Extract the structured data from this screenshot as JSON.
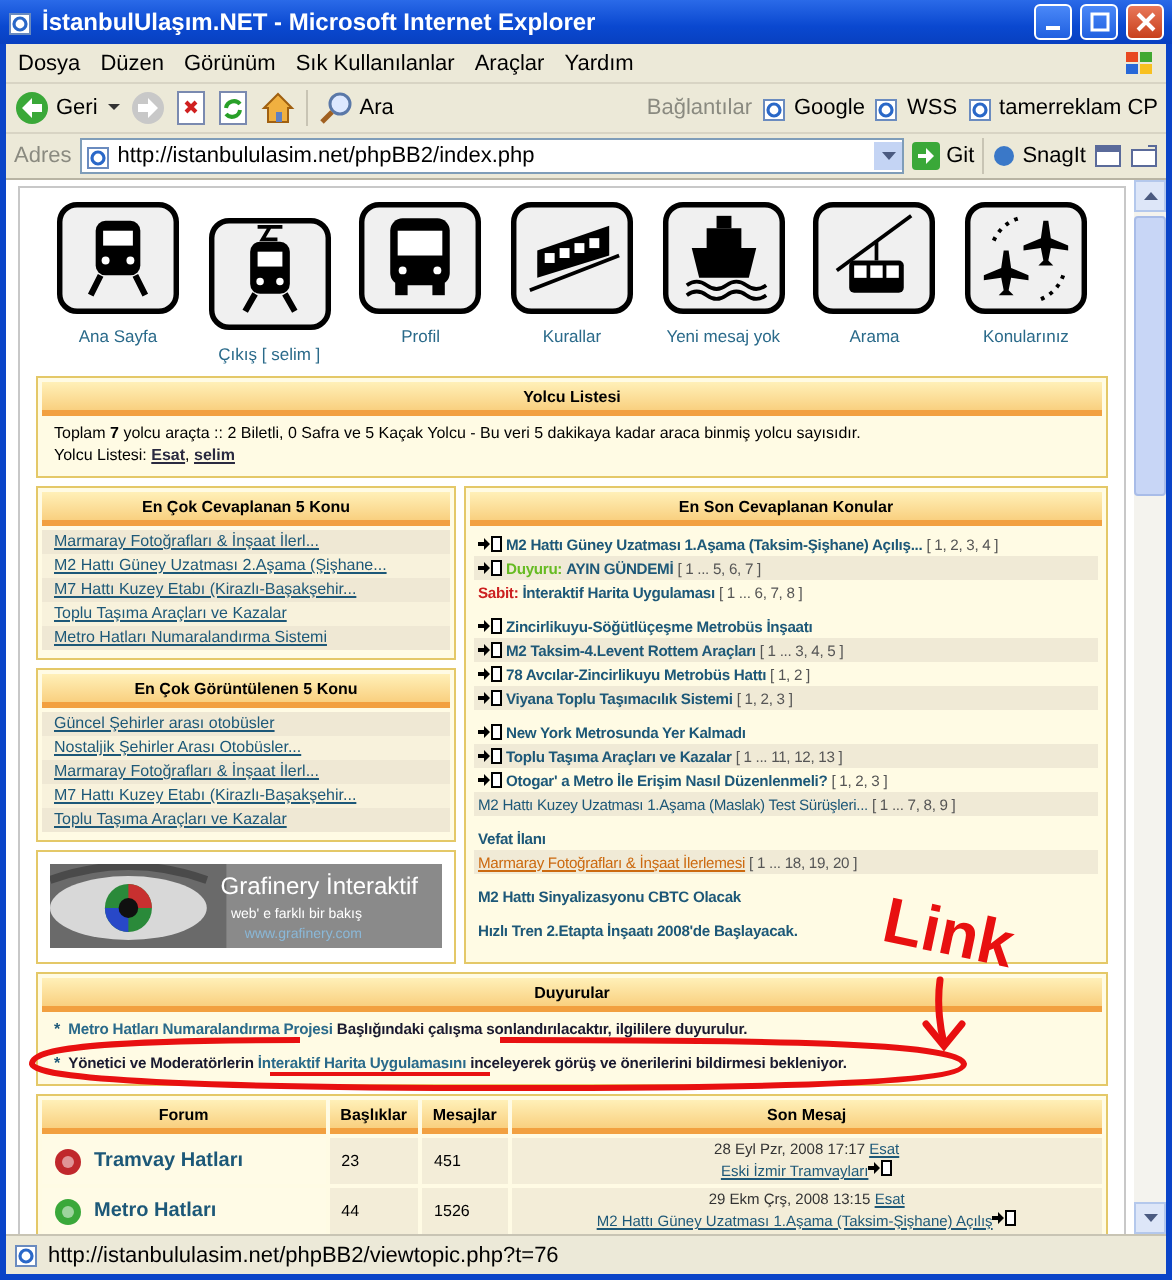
{
  "window": {
    "title": "İstanbulUlaşım.NET - Microsoft Internet Explorer"
  },
  "menu": [
    "Dosya",
    "Düzen",
    "Görünüm",
    "Sık Kullanılanlar",
    "Araçlar",
    "Yardım"
  ],
  "toolbar": {
    "back": "Geri",
    "search": "Ara",
    "links_label": "Bağlantılar",
    "links": [
      "Google",
      "WSS",
      "tamerreklam CP"
    ]
  },
  "address": {
    "label": "Adres",
    "url": "http://istanbululasim.net/phpBB2/index.php",
    "go": "Git",
    "snagit": "SnagIt"
  },
  "nav": [
    {
      "label": "Ana Sayfa",
      "kind": "metro"
    },
    {
      "label": "Çıkış [ selim ]",
      "kind": "tram"
    },
    {
      "label": "Profil",
      "kind": "bus"
    },
    {
      "label": "Kurallar",
      "kind": "funicular"
    },
    {
      "label": "Yeni mesaj yok",
      "kind": "ship"
    },
    {
      "label": "Arama",
      "kind": "cablecar"
    },
    {
      "label": "Konularınız",
      "kind": "planes"
    }
  ],
  "online": {
    "title": "Yolcu Listesi",
    "summary": "Toplam **7** yolcu araçta :: 2 Biletli, 0 Safra ve 5 Kaçak Yolcu - Bu veri 5 dakikaya kadar araca binmiş yolcu sayısıdır.",
    "list_label": "Yolcu Listesi:",
    "users": [
      "Esat",
      "selim"
    ],
    "separator": ","
  },
  "most_replied": {
    "title": "En Çok Cevaplanan 5 Konu",
    "items": [
      "Marmaray Fotoğrafları & İnşaat İlerl...",
      "M2 Hattı Güney Uzatması 2.Aşama (Şişhane...",
      "M7 Hattı Kuzey Etabı (Kirazlı-Başakşehir...",
      "Toplu Taşıma Araçları ve Kazalar",
      "Metro Hatları Numaralandırma Sistemi"
    ]
  },
  "most_viewed": {
    "title": "En Çok Görüntülenen 5 Konu",
    "items": [
      "Güncel Şehirler arası otobüsler",
      "Nostaljik Şehirler Arası Otobüsler...",
      "Marmaray Fotoğrafları & İnşaat İlerl...",
      "M7 Hattı Kuzey Etabı (Kirazlı-Başakşehir...",
      "Toplu Taşıma Araçları ve Kazalar"
    ]
  },
  "banner": {
    "title": "Grafinery İnteraktif",
    "tagline": "web' e farklı bir bakış",
    "url": "www.grafinery.com"
  },
  "latest": {
    "title": "En Son Cevaplanan Konular",
    "groups": [
      {
        "topics": [
          {
            "kind": "topic",
            "title": "M2 Hattı Güney Uzatması 1.Aşama (Taksim-Şişhane) Açılış...",
            "pages": "[ 1, 2, 3, 4 ]",
            "color": "#1d5878"
          },
          {
            "kind": "topic",
            "prefix": {
              "text": "Duyuru:",
              "color": "#66bb22"
            },
            "title": "AYIN GÜNDEMİ",
            "pages": "[ 1 ... 5, 6, 7 ]",
            "color": "#1d5878"
          },
          {
            "kind": "link",
            "prefix": {
              "text": "Sabit:",
              "color": "#cc2020"
            },
            "title": "İnteraktif Harita Uygulaması",
            "pages": "[ 1 ... 6, 7, 8 ]",
            "color": "#1d5878"
          }
        ]
      },
      {
        "topics": [
          {
            "kind": "topic",
            "title": "Zincirlikuyu-Söğütlüçeşme Metrobüs İnşaatı",
            "color": "#1d5878"
          },
          {
            "kind": "topic",
            "title": "M2 Taksim-4.Levent Rottem Araçları",
            "pages": "[ 1 ... 3, 4, 5 ]",
            "color": "#1d5878"
          },
          {
            "kind": "topic",
            "title": "78 Avcılar-Zincirlikuyu Metrobüs Hattı",
            "pages": "[ 1, 2 ]",
            "color": "#1d5878"
          },
          {
            "kind": "topic",
            "title": "Viyana Toplu Taşımacılık Sistemi",
            "pages": "[ 1, 2, 3 ]",
            "color": "#1d5878"
          }
        ]
      },
      {
        "topics": [
          {
            "kind": "topic",
            "title": "New York Metrosunda Yer Kalmadı",
            "color": "#1d5878"
          },
          {
            "kind": "topic",
            "title": "Toplu Taşıma Araçları ve Kazalar",
            "pages": "[ 1 ... 11, 12, 13 ]",
            "color": "#1d5878"
          },
          {
            "kind": "topic",
            "title": "Otogar' a Metro İle Erişim Nasıl Düzenlenmeli?",
            "pages": "[ 1, 2, 3 ]",
            "color": "#1d5878"
          },
          {
            "kind": "plain",
            "title": "M2 Hattı Kuzey Uzatması 1.Aşama (Maslak) Test Sürüşleri...",
            "pages": "[ 1 ... 7, 8, 9 ]",
            "color": "#1d5878"
          }
        ]
      },
      {
        "topics": [
          {
            "kind": "link",
            "title": "Vefat İlanı",
            "color": "#1d5878"
          },
          {
            "kind": "plain",
            "title": "Marmaray Fotoğrafları & İnşaat İlerlemesi",
            "pages": "[ 1 ... 18, 19, 20 ]",
            "color": "#cc6a10"
          }
        ]
      },
      {
        "topics": [
          {
            "kind": "link",
            "title": "M2 Hattı Sinyalizasyonu CBTC Olacak",
            "color": "#1d5878"
          }
        ]
      },
      {
        "topics": [
          {
            "kind": "link",
            "title": "Hızlı Tren 2.Etapta İnşaatı 2008'de Başlayacak.",
            "color": "#1d5878"
          }
        ]
      }
    ]
  },
  "announcements": {
    "title": "Duyurular",
    "items": [
      {
        "bullet": "*",
        "parts": [
          {
            "kind": "link",
            "text": "Metro Hatları Numaralandırma Projesi"
          },
          {
            "kind": "text",
            "text": " Başlığındaki çalışma sonlandırılacaktır, ilgililere duyurulur."
          }
        ]
      },
      {
        "bullet": "*",
        "parts": [
          {
            "kind": "text",
            "text": "Yönetici ve Moderatörlerin "
          },
          {
            "kind": "link",
            "text": "İnteraktif Harita Uygulamasını"
          },
          {
            "kind": "text",
            "text": " inceleyerek görüş ve önerilerini bildirmesi bekleniyor."
          }
        ]
      }
    ]
  },
  "forum": {
    "columns": [
      "Forum",
      "Başlıklar",
      "Mesajlar",
      "Son Mesaj"
    ],
    "rows": [
      {
        "name": "Tramvay Hatları",
        "color": "#c0282c",
        "topics": "23",
        "posts": "451",
        "last_date": "28 Eyl Pzr, 2008 17:17",
        "last_user": "Esat",
        "last_topic": "Eski İzmir Tramvayları"
      },
      {
        "name": "Metro Hatları",
        "color": "#3aa83a",
        "topics": "44",
        "posts": "1526",
        "last_date": "29 Ekm Çrş, 2008 13:15",
        "last_user": "Esat",
        "last_topic": "M2 Hattı Güney Uzatması 1.Aşama (Taksim-Şişhane) Açılış"
      }
    ]
  },
  "status_bar": {
    "text": "http://istanbululasim.net/phpBB2/viewtopic.php?t=76"
  },
  "annotation": {
    "text": "Link"
  }
}
